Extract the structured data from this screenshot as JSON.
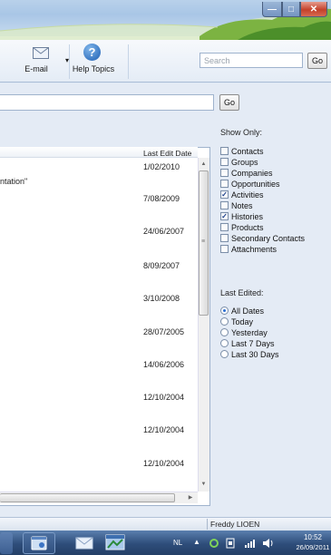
{
  "window": {
    "minimize_glyph": "—",
    "maximize_glyph": "□",
    "close_glyph": "✕"
  },
  "toolbar": {
    "email_label": "E-mail",
    "help_label": "Help Topics",
    "help_glyph": "?",
    "search_placeholder": "Search",
    "search_go": "Go"
  },
  "filter": {
    "go_label": "Go"
  },
  "grid": {
    "column_header": "Last Edit Date",
    "fragment_text": "ntation\"",
    "dates": [
      "1/02/2010",
      "7/08/2009",
      "24/06/2007",
      "8/09/2007",
      "3/10/2008",
      "28/07/2005",
      "14/06/2006",
      "12/10/2004",
      "12/10/2004",
      "12/10/2004"
    ]
  },
  "show_only": {
    "label": "Show Only:",
    "items": [
      {
        "label": "Contacts",
        "checked": false
      },
      {
        "label": "Groups",
        "checked": false
      },
      {
        "label": "Companies",
        "checked": false
      },
      {
        "label": "Opportunities",
        "checked": false
      },
      {
        "label": "Activities",
        "checked": true
      },
      {
        "label": "Notes",
        "checked": false
      },
      {
        "label": "Histories",
        "checked": true
      },
      {
        "label": "Products",
        "checked": false
      },
      {
        "label": "Secondary Contacts",
        "checked": false
      },
      {
        "label": "Attachments",
        "checked": false
      }
    ]
  },
  "last_edited": {
    "label": "Last Edited:",
    "options": [
      {
        "label": "All Dates",
        "selected": true
      },
      {
        "label": "Today",
        "selected": false
      },
      {
        "label": "Yesterday",
        "selected": false
      },
      {
        "label": "Last 7 Days",
        "selected": false
      },
      {
        "label": "Last 30 Days",
        "selected": false
      }
    ]
  },
  "status": {
    "user": "Freddy LIOEN"
  },
  "taskbar": {
    "language": "NL",
    "time": "10:52",
    "date": "26/09/2011"
  },
  "colors": {
    "accent": "#2a6ed2",
    "taskbar": "#2e4d7a"
  }
}
